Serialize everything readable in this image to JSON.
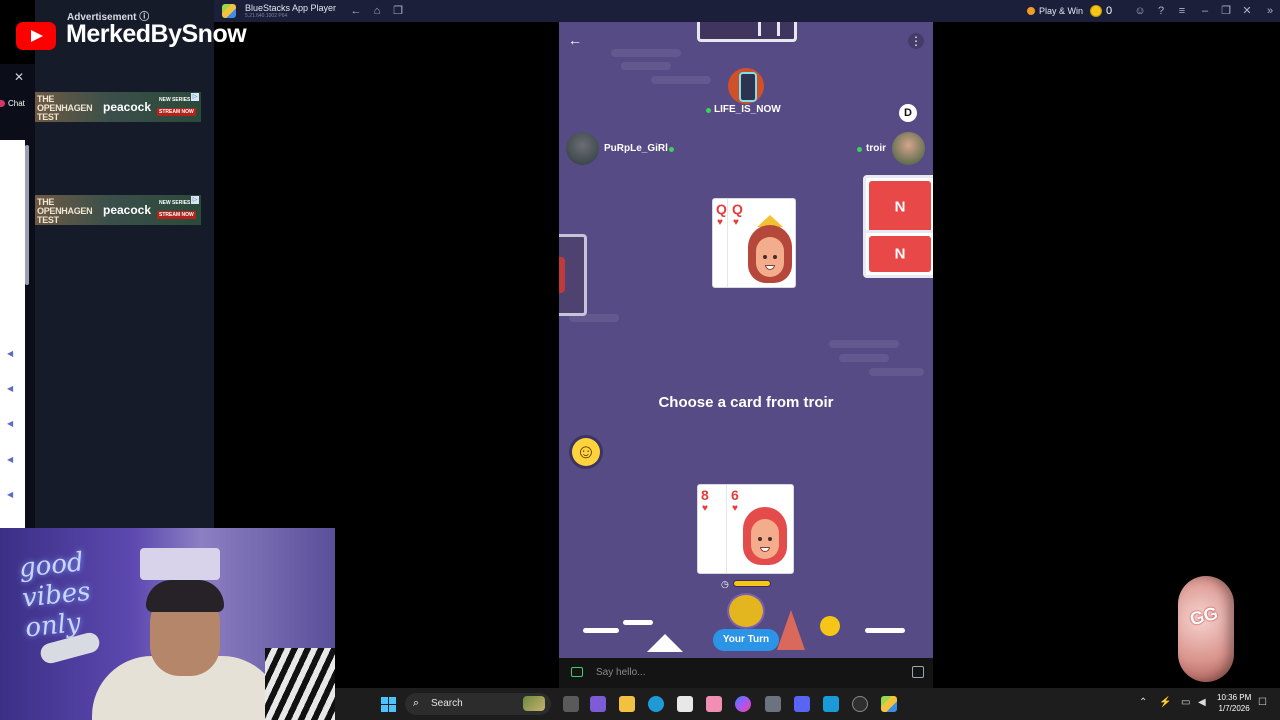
{
  "titlebar": {
    "app_name": "BlueStacks App Player",
    "version": "5.21.640.1002 P64",
    "play_win": "Play & Win",
    "coins": "0"
  },
  "ad": {
    "header": "Advertisement ⓘ",
    "banner_title": "THE OPENHAGEN TEST",
    "banner_brand": "peacock",
    "banner_new": "NEW SERIES",
    "banner_cta": "STREAM NOW"
  },
  "left": {
    "chat_label": "Chat"
  },
  "stream": {
    "channel": "MerkedBySnow",
    "neon": "good vibes only"
  },
  "game": {
    "players": {
      "top": "LIFE_IS_NOW",
      "left": "PuRpLe_GiRl",
      "right": "troir",
      "dealer_badge": "D"
    },
    "center_cards": [
      {
        "rank": "Q",
        "suit": "♥"
      },
      {
        "rank": "Q",
        "suit": "♥"
      }
    ],
    "hand_cards": [
      {
        "rank": "8",
        "suit": "♥"
      },
      {
        "rank": "6",
        "suit": "♥"
      }
    ],
    "opponent_card_letter": "N",
    "prompt": "Choose a card from troir",
    "your_turn": "Your Turn",
    "chat_placeholder": "Say hello..."
  },
  "sticker": {
    "text": "GG"
  },
  "taskbar": {
    "search": "Search",
    "time": "10:36 PM",
    "date": "1/7/2026"
  },
  "colors": {
    "game_bg": "#574b85",
    "card_red": "#e63c3c",
    "your_turn": "#2b94e6",
    "titlebar": "#1b1f3a"
  }
}
